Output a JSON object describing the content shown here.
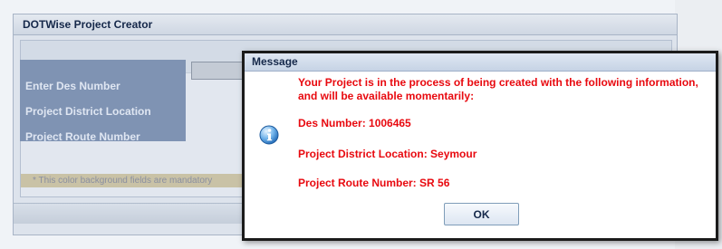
{
  "app": {
    "title": "DOTWise Project Creator",
    "form": {
      "des_number_label": "Enter Des Number",
      "district_label": "Project District Location",
      "route_label": "Project Route Number"
    },
    "mandatory_note": "* This color background fields are mandatory"
  },
  "dialog": {
    "title": "Message",
    "icon": "info-icon",
    "intro_line1": "Your Project is in the process of being created with the following information,",
    "intro_line2": "and will be available momentarily:",
    "des_number": "Des Number: 1006465",
    "district": "Project District Location: Seymour",
    "route": "Project Route Number: SR 56",
    "ok_label": "OK"
  },
  "colors": {
    "message_text": "#e8090f",
    "label_column": "#7f93b3",
    "dialog_border": "#1b1b1b"
  }
}
